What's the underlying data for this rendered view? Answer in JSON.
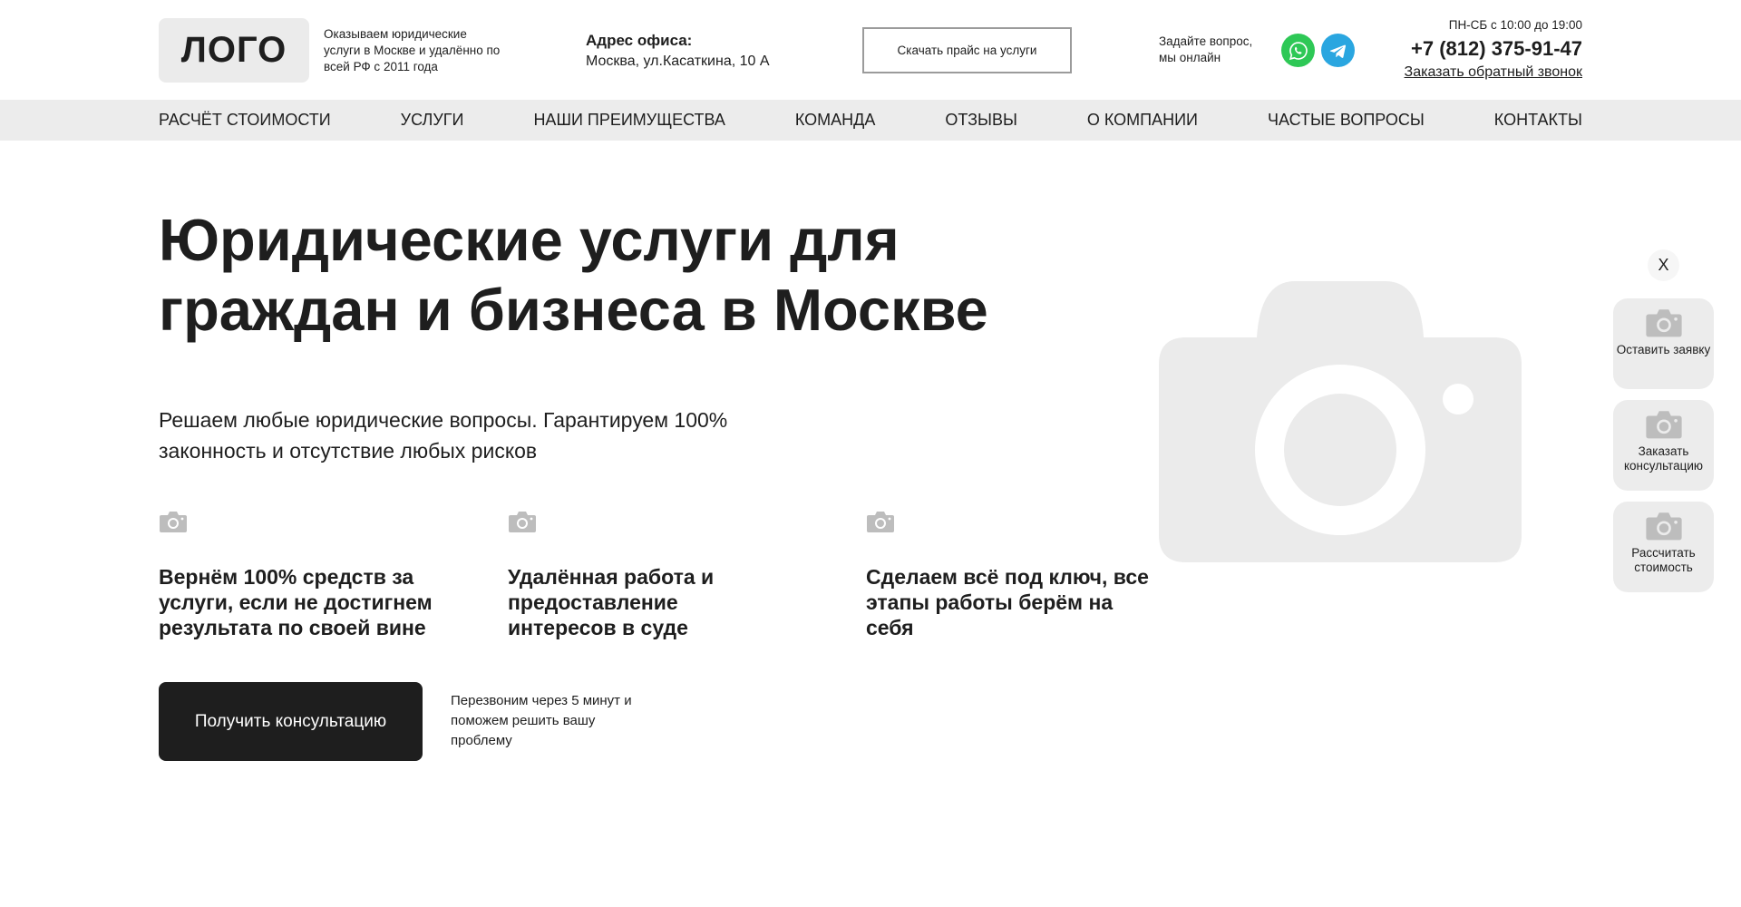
{
  "header": {
    "logo": "ЛОГО",
    "tagline": "Оказываем юридические услуги в Москве и удалённо по всей РФ с 2011 года",
    "address_label": "Адрес офиса:",
    "address_value": "Москва,  ул.Касаткина, 10 А",
    "price_button": "Скачать прайс на услуги",
    "ask_text": "Задайте вопрос, мы онлайн",
    "whatsapp_icon": "whatsapp-icon",
    "telegram_icon": "telegram-icon",
    "hours": "ПН-СБ с 10:00 до 19:00",
    "phone": "+7 (812) 375-91-47",
    "callback": "Заказать обратный звонок"
  },
  "nav": {
    "items": [
      "РАСЧЁТ СТОИМОСТИ",
      "УСЛУГИ",
      "НАШИ ПРЕИМУЩЕСТВА",
      "КОМАНДА",
      "ОТЗЫВЫ",
      "О КОМПАНИИ",
      "ЧАСТЫЕ ВОПРОСЫ",
      "КОНТАКТЫ"
    ]
  },
  "hero": {
    "title_line1": "Юридические услуги для",
    "title_line2": "граждан и бизнеса в Москве",
    "subtitle": "Решаем любые юридические вопросы. Гарантируем 100% законность и отсутствие любых рисков",
    "features": [
      "Вернём 100% средств за услуги, если не достигнем результата по своей вине",
      "Удалённая работа и предоставление интересов в суде",
      "Сделаем всё под ключ, все этапы работы берём на себя"
    ],
    "cta_button": "Получить консультацию",
    "cta_note": "Перезвоним через 5 минут и поможем решить вашу проблему",
    "image_icon": "camera-icon"
  },
  "side_widget": {
    "close": "X",
    "buttons": [
      "Оставить заявку",
      "Заказать консультацию",
      "Рассчитать стоимость"
    ]
  },
  "colors": {
    "text": "#1e1e1e",
    "nav_bg": "#ececec",
    "placeholder": "#ebebeb",
    "whatsapp": "#2ec856",
    "telegram": "#2aa6e0",
    "cta_bg": "#1e1e1e"
  }
}
